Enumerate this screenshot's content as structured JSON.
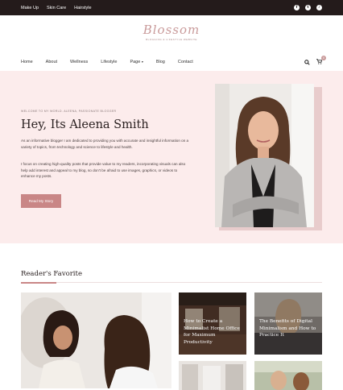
{
  "topbar": {
    "links": [
      "Make Up",
      "Skin Care",
      "Hairstyle"
    ],
    "social": [
      {
        "icon": "facebook-icon",
        "glyph": "f"
      },
      {
        "icon": "twitter-icon",
        "glyph": "t"
      },
      {
        "icon": "tiktok-icon",
        "glyph": "♪"
      }
    ]
  },
  "logo": {
    "script": "Blossom",
    "tagline": "BLOGGING & LIFESTYLE WEBSITE"
  },
  "nav": {
    "items": [
      "Home",
      "About",
      "Wellness",
      "Lifestyle",
      "Page",
      "Blog",
      "Contact"
    ],
    "cart_count": "0"
  },
  "hero": {
    "breadcrumb": "WELCOME TO MY WORLD. ALEENA, PASSIONATE BLOGGER",
    "title": "Hey, Its Aleena Smith",
    "paragraph1": "As an informative blogger I am dedicated to providing you with accurate and insightful information on a variety of topics, from technology and science to lifestyle and health.",
    "paragraph2": "I focus on creating high-quality posts that provide value to my readers, incorporating visuals can also help add interest and appeal to my blog, so don't be afraid to use images, graphics, or videos to enhance my posts.",
    "button": "Read My Story"
  },
  "favorites": {
    "heading": "Reader's Favorite",
    "cards": [
      {
        "title": "How to Create a Minimalist Home Office for Maximum Productivity"
      },
      {
        "title": "The Benefits of Digital Minimalism and How to Practice It"
      }
    ]
  },
  "colors": {
    "accent": "#c98686",
    "hero_bg": "#fcecec",
    "topbar": "#241b1b"
  }
}
